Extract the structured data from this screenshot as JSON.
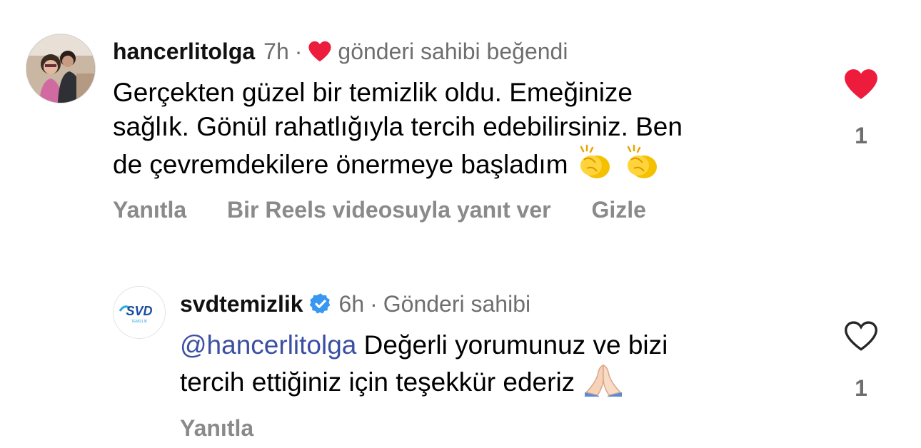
{
  "comments": [
    {
      "username": "hancerlitolga",
      "time": "7h",
      "dot": "·",
      "creator_liked": "gönderi sahibi beğendi",
      "text_line1": "Gerçekten güzel bir temizlik oldu. Emeğinize",
      "text_line2": "sağlık. Gönül rahatlığıyla tercih edebilirsiniz. Ben",
      "text_line3": "de çevremdekilere önermeye başladım",
      "actions": {
        "reply": "Yanıtla",
        "reels_reply": "Bir Reels videosuyla yanıt ver",
        "hide": "Gizle"
      },
      "like_count": "1",
      "liked": true,
      "like_color": "#ed4956"
    },
    {
      "username": "svdtemizlik",
      "verified": true,
      "verified_color": "#3897f0",
      "time": "6h",
      "dot": "·",
      "author_label": "Gönderi sahibi",
      "mention": "@hancerlitolga",
      "text_line1": "Değerli yorumunuz ve bizi",
      "text_line2": "tercih ettiğiniz için teşekkür ederiz",
      "actions": {
        "reply": "Yanıtla"
      },
      "like_count": "1",
      "liked": false,
      "logo_text": "SVD",
      "logo_subtext": "TEMİZLİK"
    }
  ],
  "icons": [
    "heart-small-icon",
    "heart-filled-icon",
    "heart-outline-icon",
    "verified-badge-icon",
    "clapping-hands-icon",
    "praying-hands-icon"
  ]
}
